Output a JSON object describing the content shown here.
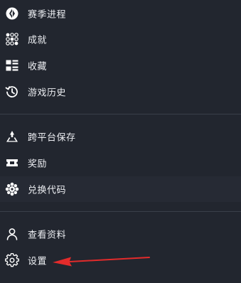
{
  "menu": {
    "items": [
      {
        "label": "赛季进程",
        "icon": "season-progress-icon"
      },
      {
        "label": "成就",
        "icon": "achievements-icon"
      },
      {
        "label": "收藏",
        "icon": "collection-icon"
      },
      {
        "label": "游戏历史",
        "icon": "history-icon"
      },
      {
        "label": "跨平台保存",
        "icon": "cross-platform-icon"
      },
      {
        "label": "奖励",
        "icon": "ticket-icon"
      },
      {
        "label": "兑换代码",
        "icon": "redeem-icon"
      },
      {
        "label": "查看资料",
        "icon": "profile-icon"
      },
      {
        "label": "设置",
        "icon": "gear-icon"
      }
    ]
  },
  "colors": {
    "background": "#22262f",
    "hover_background": "#262a34",
    "divider": "#3a3f4a",
    "text": "#eceef2",
    "arrow": "#e32b2b"
  }
}
